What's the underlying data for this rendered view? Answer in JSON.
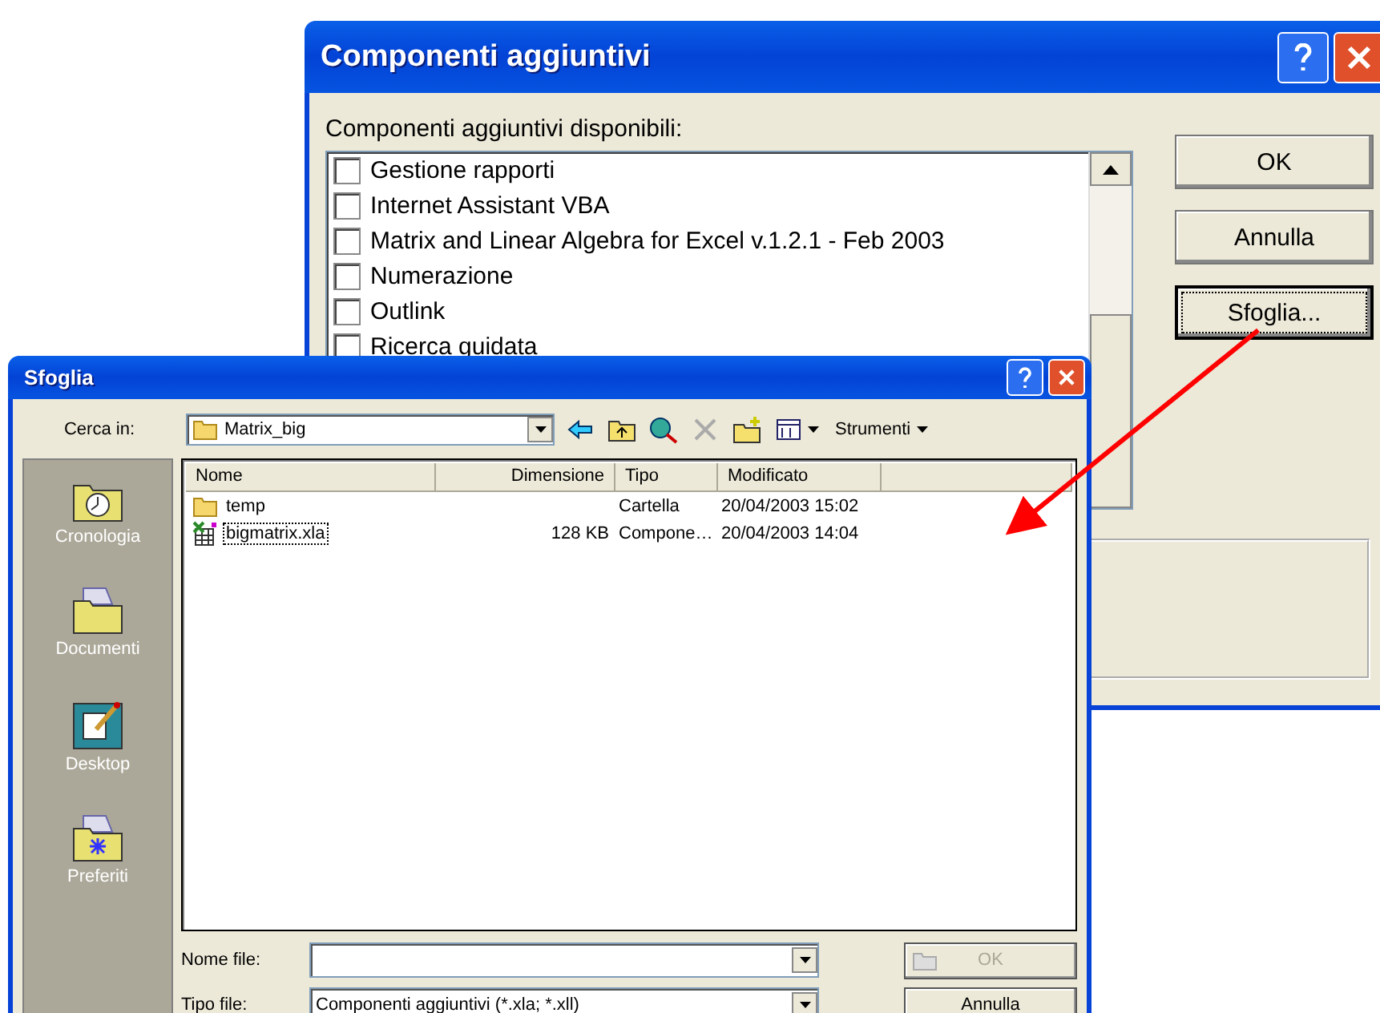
{
  "addins_dialog": {
    "title": "Componenti aggiuntivi",
    "list_label": "Componenti aggiuntivi disponibili:",
    "items": [
      {
        "label": "Gestione rapporti",
        "checked": false
      },
      {
        "label": "Internet Assistant VBA",
        "checked": false
      },
      {
        "label": "Matrix and Linear Algebra for Excel  v.1.2.1 - Feb 2003",
        "checked": false
      },
      {
        "label": "Numerazione",
        "checked": false
      },
      {
        "label": "Outlink",
        "checked": false
      },
      {
        "label": "Ricerca guidata",
        "checked": false
      }
    ],
    "buttons": [
      {
        "label": "OK",
        "focused": false
      },
      {
        "label": "Annulla",
        "focused": false
      },
      {
        "label": "Sfoglia...",
        "focused": true
      }
    ]
  },
  "browse_dialog": {
    "title": "Sfoglia",
    "look_in_label": "Cerca in:",
    "look_in_value": "Matrix_big",
    "tools_label": "Strumenti",
    "places": [
      {
        "label": "Cronologia",
        "kind": "history"
      },
      {
        "label": "Documenti",
        "kind": "documents"
      },
      {
        "label": "Desktop",
        "kind": "desktop"
      },
      {
        "label": "Preferiti",
        "kind": "favorites"
      }
    ],
    "columns": [
      "Nome",
      "Dimensione",
      "Tipo",
      "Modificato"
    ],
    "files": [
      {
        "kind": "folder",
        "name": "temp",
        "type": "Cartella",
        "modified": "20/04/2003 15:02",
        "focused": false
      },
      {
        "kind": "addin",
        "name": "bigmatrix.xla",
        "size": "128 KB",
        "type": "Compone…",
        "modified": "20/04/2003 14:04",
        "focused": true
      }
    ],
    "file_name_label": "Nome file:",
    "file_type_label": "Tipo file:",
    "file_type_value": "Componenti aggiuntivi (*.xla; *.xll)",
    "buttons": [
      {
        "label": "OK",
        "disabled": true
      },
      {
        "label": "Annulla",
        "disabled": false
      }
    ]
  }
}
